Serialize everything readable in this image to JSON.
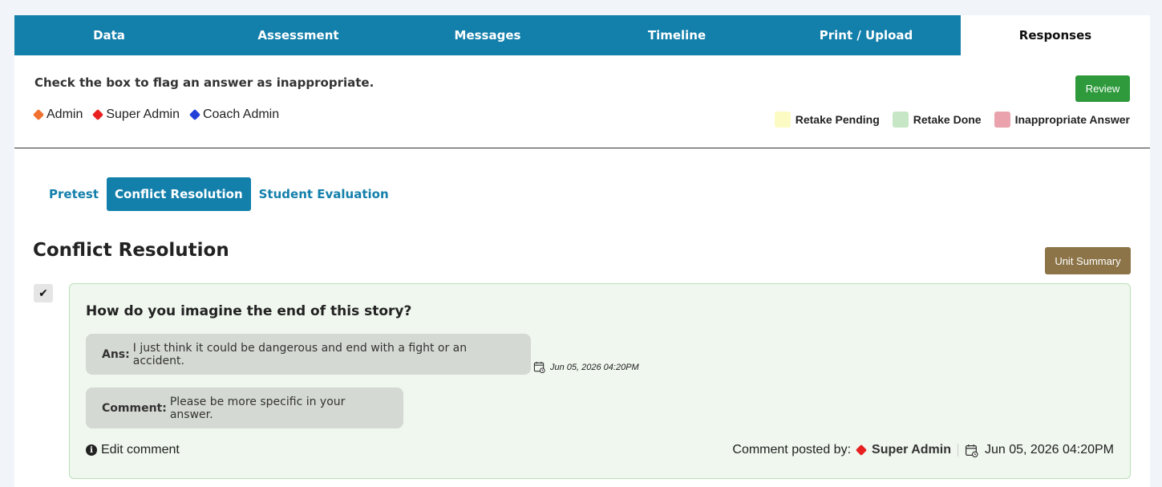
{
  "tabs": [
    "Data",
    "Assessment",
    "Messages",
    "Timeline",
    "Print / Upload",
    "Responses"
  ],
  "active_tab": "Responses",
  "instruction": "Check the box to flag an answer as inappropriate.",
  "roles": [
    {
      "label": "Admin",
      "color": "#f07030"
    },
    {
      "label": "Super Admin",
      "color": "#e82020"
    },
    {
      "label": "Coach Admin",
      "color": "#2040d8"
    }
  ],
  "review_label": "Review",
  "status_legend": [
    {
      "label": "Retake Pending",
      "color": "#fdfbc4"
    },
    {
      "label": "Retake Done",
      "color": "#c7e6c5"
    },
    {
      "label": "Inappropriate Answer",
      "color": "#eaa3ac"
    }
  ],
  "subtabs": [
    "Pretest",
    "Conflict Resolution",
    "Student Evaluation"
  ],
  "active_subtab": "Conflict Resolution",
  "section_title": "Conflict Resolution",
  "unit_summary_label": "Unit Summary",
  "checkbox_mark": "✔",
  "response": {
    "question": "How do you imagine the end of this story?",
    "answer_label": "Ans:",
    "answer_text": "I just think it could be dangerous and end with a fight or an accident.",
    "answer_date": "Jun 05, 2026 04:20PM",
    "comment_label": "Comment:",
    "comment_text": "Please be more specific in your answer.",
    "edit_label": "Edit comment",
    "posted_by_label": "Comment posted by:",
    "posted_by": "Super Admin",
    "posted_by_color": "#e82020",
    "posted_date": "Jun 05, 2026 04:20PM"
  }
}
